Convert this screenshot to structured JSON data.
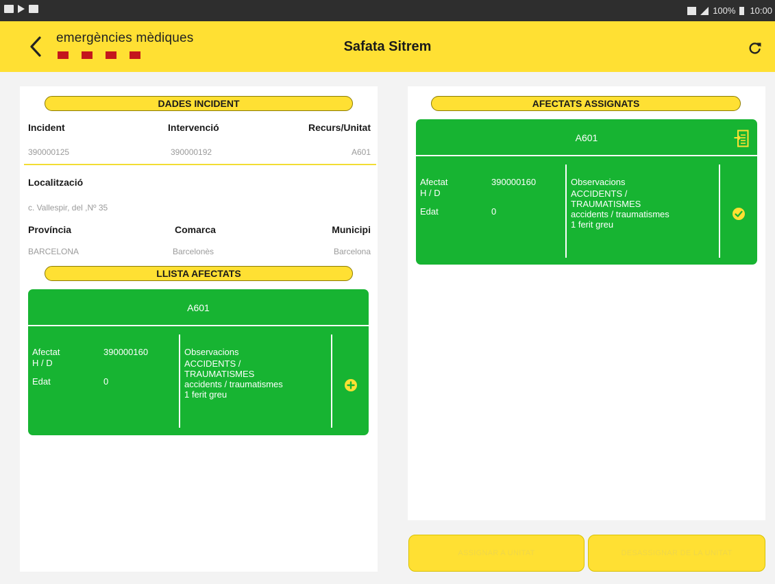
{
  "status_bar": {
    "battery": "100%",
    "time": "10:00"
  },
  "header": {
    "logo_text": "emergències mèdiques",
    "title": "Safata Sitrem"
  },
  "incident_panel": {
    "title": "DADES INCIDENT",
    "incident_label": "Incident",
    "incident_value": "390000125",
    "intervencio_label": "Intervenció",
    "intervencio_value": "390000192",
    "recurs_label": "Recurs/Unitat",
    "recurs_value": "A601",
    "localitzacio_label": "Localització",
    "localitzacio_value": "c. Vallespir, del ,Nº 35",
    "provincia_label": "Província",
    "provincia_value": "BARCELONA",
    "comarca_label": "Comarca",
    "comarca_value": "Barcelonès",
    "municipi_label": "Municipi",
    "municipi_value": "Barcelona"
  },
  "llista_afectats": {
    "title": "LLISTA AFECTATS",
    "card": {
      "unit": "A601",
      "afectat_label": "Afectat",
      "afectat_value": "390000160",
      "hd_label": "H / D",
      "edat_label": "Edat",
      "edat_value": "0",
      "obs_label": "Observacions",
      "obs_line1": "ACCIDENTS /",
      "obs_line2": "TRAUMATISMES",
      "obs_line3": "accidents / traumatismes",
      "obs_line4": "1 ferit greu"
    }
  },
  "afectats_assignats": {
    "title": "AFECTATS ASSIGNATS",
    "card": {
      "unit": "A601",
      "afectat_label": "Afectat",
      "afectat_value": "390000160",
      "hd_label": "H / D",
      "edat_label": "Edat",
      "edat_value": "0",
      "obs_label": "Observacions",
      "obs_line1": "ACCIDENTS /",
      "obs_line2": "TRAUMATISMES",
      "obs_line3": "accidents / traumatismes",
      "obs_line4": "1 ferit greu"
    }
  },
  "buttons": {
    "assign": "ASSIGNAR A UNITAT",
    "unassign": "DESASSIGNAR DE LA UNITAT"
  },
  "colors": {
    "yellow": "#ffe033",
    "green": "#17b432",
    "red": "#c4161c"
  }
}
